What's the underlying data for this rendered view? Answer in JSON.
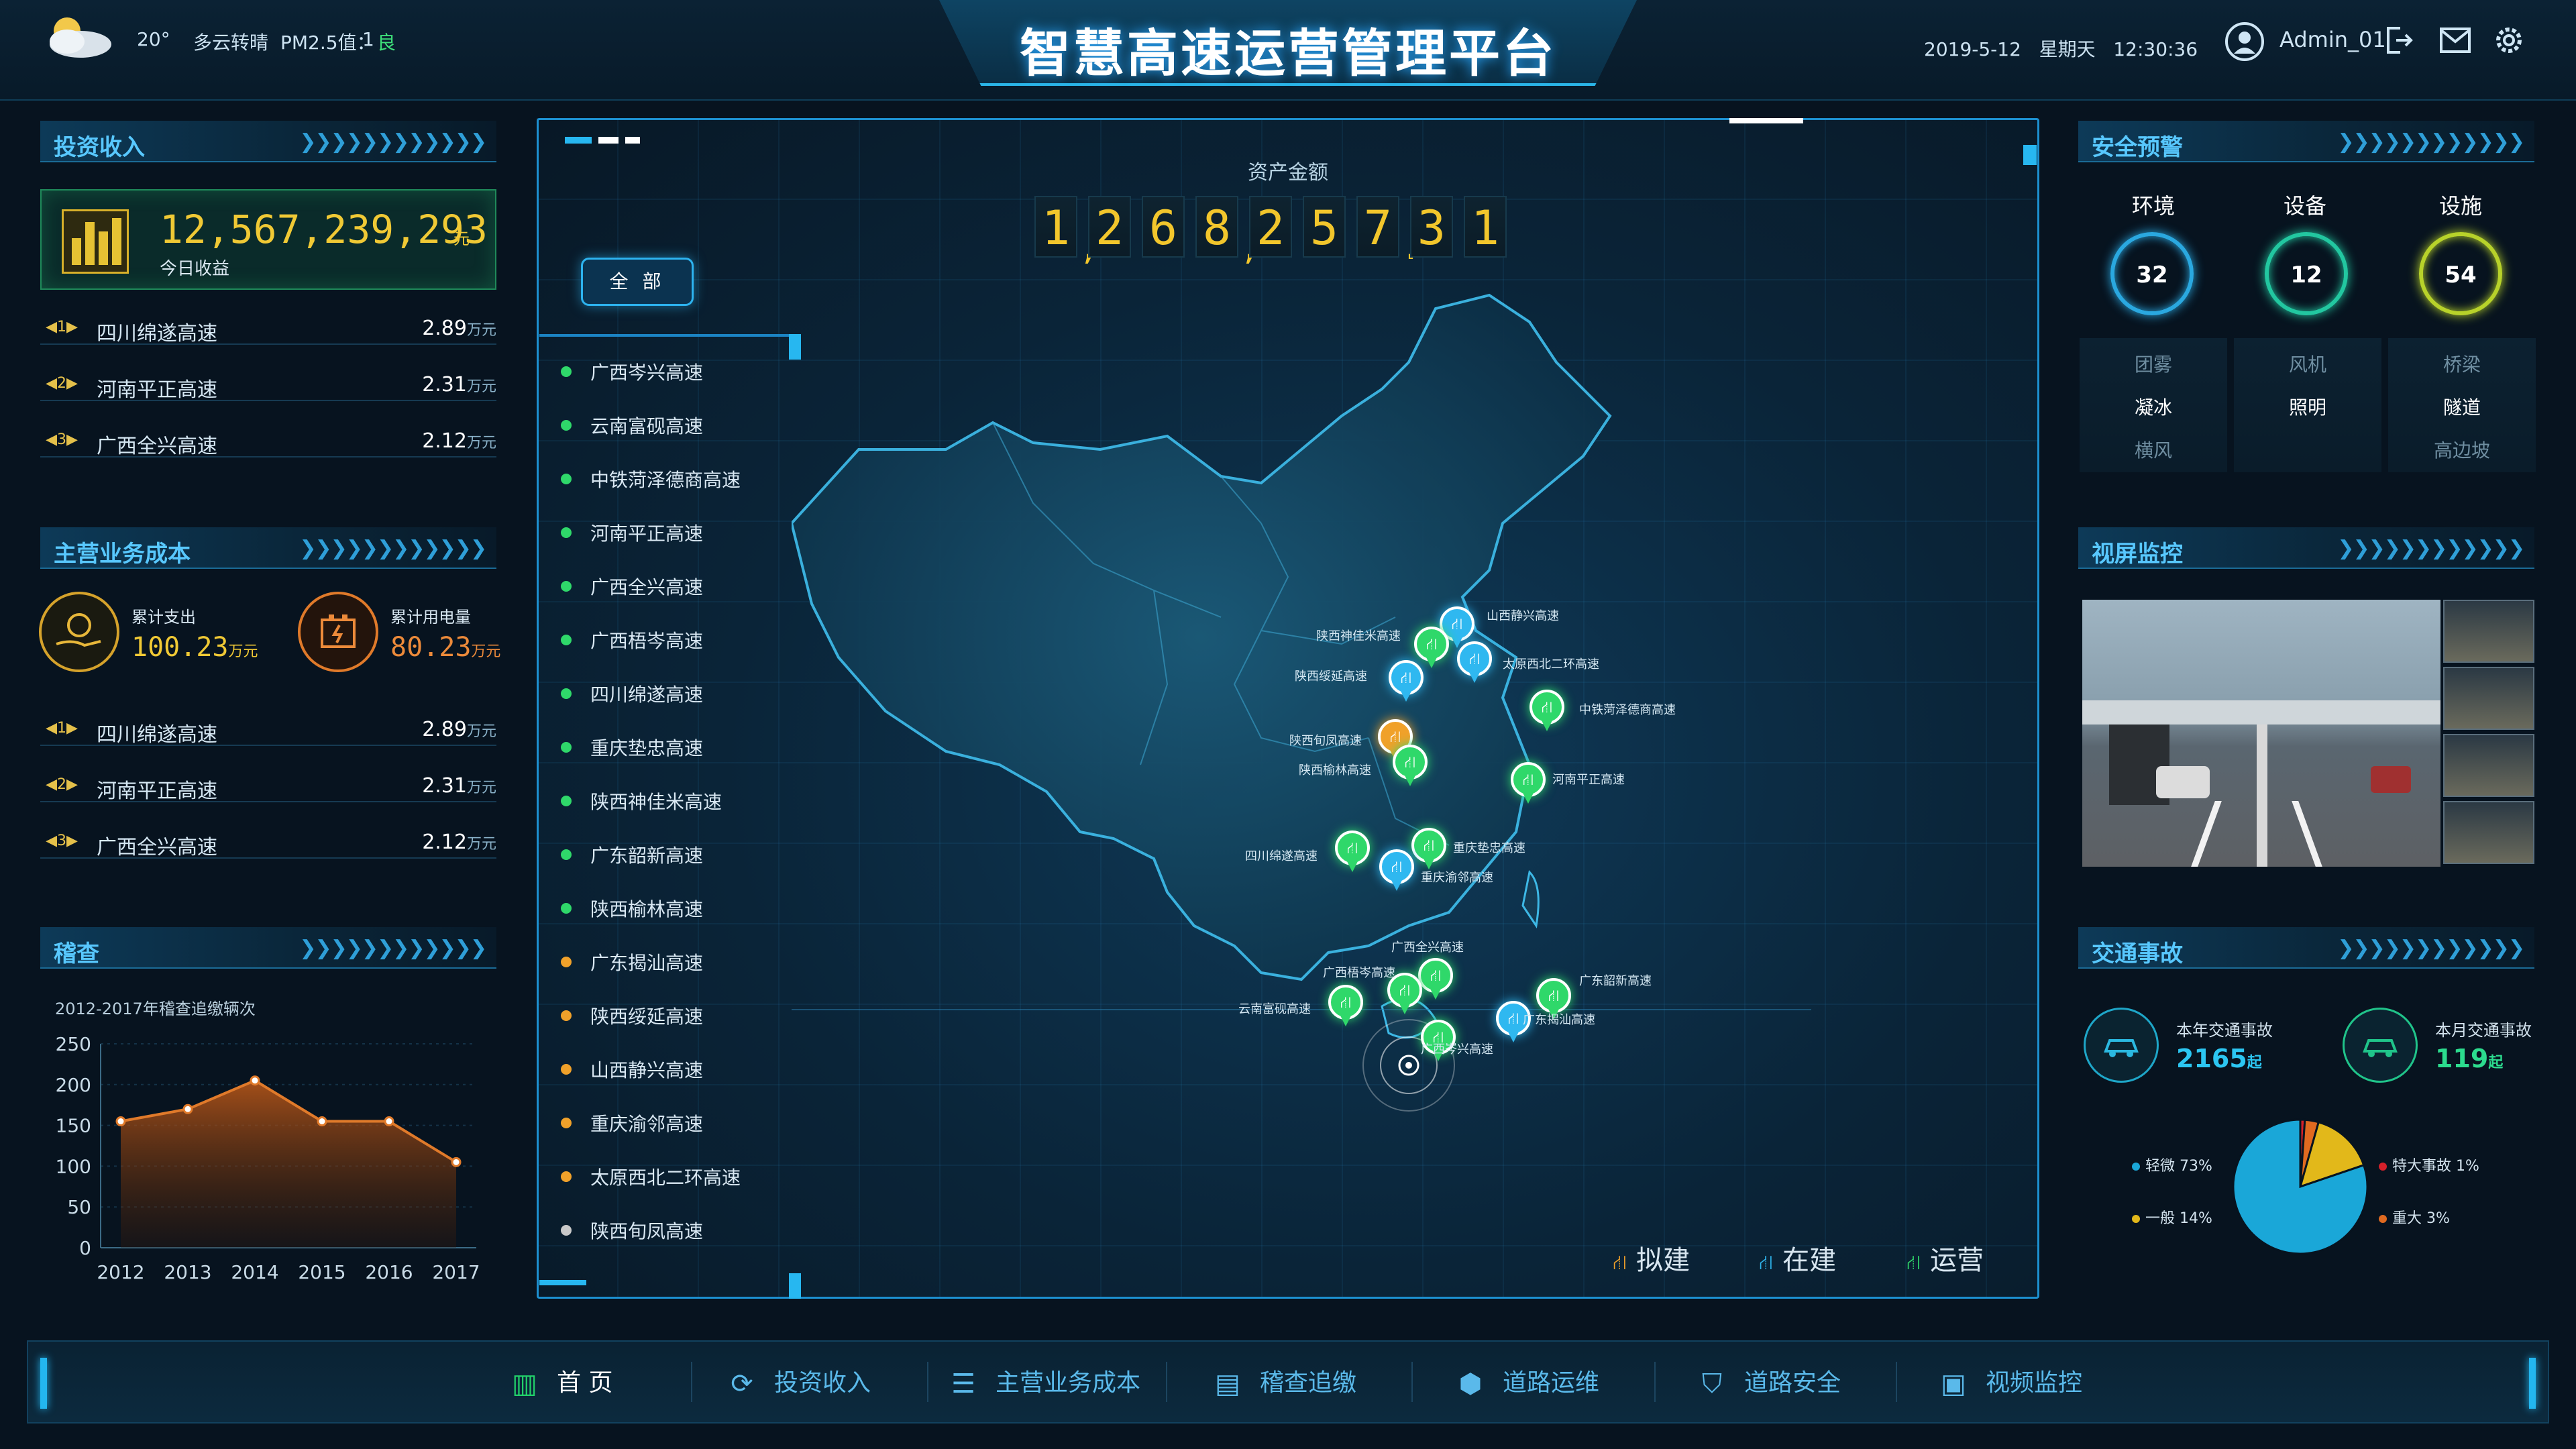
{
  "header": {
    "temperature": "20°",
    "weather": "多云转晴",
    "pm_label": "PM2.5值：",
    "pm_value": "1",
    "pm_quality": "良",
    "title": "智慧高速运营管理平台",
    "datetime": "2019-5-12   星期天   12:30:36",
    "username": "Admin_01"
  },
  "investment": {
    "title": "投资收入",
    "amount": "12,567,239,293",
    "unit": "元",
    "sub": "今日收益",
    "ranking": [
      {
        "rank": "1",
        "name": "四川绵遂高速",
        "value": "2.89",
        "unit": "万元"
      },
      {
        "rank": "2",
        "name": "河南平正高速",
        "value": "2.31",
        "unit": "万元"
      },
      {
        "rank": "3",
        "name": "广西全兴高速",
        "value": "2.12",
        "unit": "万元"
      }
    ]
  },
  "cost": {
    "title": "主营业务成本",
    "expense_label": "累计支出",
    "expense_value": "100.23",
    "expense_unit": "万元",
    "power_label": "累计用电量",
    "power_value": "80.23",
    "power_unit": "万元",
    "ranking": [
      {
        "rank": "1",
        "name": "四川绵遂高速",
        "value": "2.89",
        "unit": "万元"
      },
      {
        "rank": "2",
        "name": "河南平正高速",
        "value": "2.31",
        "unit": "万元"
      },
      {
        "rank": "3",
        "name": "广西全兴高速",
        "value": "2.12",
        "unit": "万元"
      }
    ]
  },
  "audit": {
    "title": "稽查",
    "chart_caption": "2012-2017年稽查追缴辆次"
  },
  "chart_data": {
    "type": "area",
    "title": "2012-2017年稽查追缴辆次",
    "x": [
      "2012",
      "2013",
      "2014",
      "2015",
      "2016",
      "2017"
    ],
    "values": [
      155,
      170,
      205,
      155,
      155,
      105
    ],
    "ylim": [
      0,
      250
    ],
    "yticks": [
      "250",
      "200",
      "150",
      "100",
      "50",
      "0"
    ],
    "color": "#e07a2a",
    "grid": true
  },
  "map": {
    "asset_label": "资产金额",
    "asset_digits": [
      "1",
      "2",
      "6",
      "8",
      "2",
      "5",
      "7",
      "3",
      "1"
    ],
    "asset_seps": [
      ",",
      ",",
      "."
    ],
    "filter_button": "全 部",
    "roads": [
      {
        "name": "广西岑兴高速",
        "color": "#2fd86a"
      },
      {
        "name": "云南富砚高速",
        "color": "#2fd86a"
      },
      {
        "name": "中铁菏泽德商高速",
        "color": "#2fd86a"
      },
      {
        "name": "河南平正高速",
        "color": "#2fd86a"
      },
      {
        "name": "广西全兴高速",
        "color": "#2fd86a"
      },
      {
        "name": "广西梧岑高速",
        "color": "#2fd86a"
      },
      {
        "name": "四川绵遂高速",
        "color": "#2fd86a"
      },
      {
        "name": "重庆垫忠高速",
        "color": "#2fd86a"
      },
      {
        "name": "陕西神佳米高速",
        "color": "#2fd86a"
      },
      {
        "name": "广东韶新高速",
        "color": "#2fd86a"
      },
      {
        "name": "陕西榆林高速",
        "color": "#2fd86a"
      },
      {
        "name": "广东揭汕高速",
        "color": "#f0a12a"
      },
      {
        "name": "陕西绥延高速",
        "color": "#f0a12a"
      },
      {
        "name": "山西静兴高速",
        "color": "#f0a12a"
      },
      {
        "name": "重庆渝邻高速",
        "color": "#f0a12a"
      },
      {
        "name": "太原西北二环高速",
        "color": "#f0a12a"
      },
      {
        "name": "陕西旬凤高速",
        "color": "#c9c9c9"
      }
    ],
    "pins": [
      {
        "label": "山西静兴高速",
        "status": "在建"
      },
      {
        "label": "陕西神佳米高速",
        "status": "运营"
      },
      {
        "label": "太原西北二环高速",
        "status": "在建"
      },
      {
        "label": "陕西绥延高速",
        "status": "在建"
      },
      {
        "label": "中铁菏泽德商高速",
        "status": "运营"
      },
      {
        "label": "陕西旬凤高速",
        "status": "拟建"
      },
      {
        "label": "陕西榆林高速",
        "status": "运营"
      },
      {
        "label": "河南平正高速",
        "status": "运营"
      },
      {
        "label": "四川绵遂高速",
        "status": "运营"
      },
      {
        "label": "重庆垫忠高速",
        "status": "运营"
      },
      {
        "label": "重庆渝邻高速",
        "status": "在建"
      },
      {
        "label": "广西全兴高速",
        "status": "运营"
      },
      {
        "label": "广西梧岑高速",
        "status": "运营"
      },
      {
        "label": "云南富砚高速",
        "status": "运营"
      },
      {
        "label": "广东韶新高速",
        "status": "运营"
      },
      {
        "label": "广东揭汕高速",
        "status": "在建"
      },
      {
        "label": "广西岑兴高速",
        "status": "运营"
      }
    ],
    "legend": [
      "拟建",
      "在建",
      "运营"
    ]
  },
  "safety": {
    "title": "安全预警",
    "columns": [
      {
        "head": "环境",
        "count": "32",
        "items": [
          "团雾",
          "凝冰",
          "横风"
        ],
        "color": "#2aa8e0"
      },
      {
        "head": "设备",
        "count": "12",
        "items": [
          "风机",
          "照明"
        ],
        "color": "#22c7a0"
      },
      {
        "head": "设施",
        "count": "54",
        "items": [
          "桥梁",
          "隧道",
          "高边坡"
        ],
        "color": "#b8d22a"
      }
    ]
  },
  "video": {
    "title": "视屏监控"
  },
  "accident": {
    "title": "交通事故",
    "year_label": "本年交通事故",
    "year_value": "2165",
    "year_unit": "起",
    "month_label": "本月交通事故",
    "month_value": "119",
    "month_unit": "起",
    "pie": [
      {
        "name": "轻微",
        "pct": "73%",
        "value": 73,
        "color": "#1aa7d8"
      },
      {
        "name": "一般",
        "pct": "14%",
        "value": 14,
        "color": "#e2b81a"
      },
      {
        "name": "特大事故",
        "pct": "1%",
        "value": 1,
        "color": "#d6202a"
      },
      {
        "name": "重大",
        "pct": "3%",
        "value": 3,
        "color": "#e06a20"
      }
    ]
  },
  "nav": {
    "items": [
      {
        "label": "首 页",
        "icon": "bar-chart-icon"
      },
      {
        "label": "投资收入",
        "icon": "share-icon"
      },
      {
        "label": "主营业务成本",
        "icon": "database-icon"
      },
      {
        "label": "稽查追缴",
        "icon": "audit-icon"
      },
      {
        "label": "道路运维",
        "icon": "maintenance-icon"
      },
      {
        "label": "道路安全",
        "icon": "shield-icon"
      },
      {
        "label": "视频监控",
        "icon": "monitor-icon"
      }
    ]
  }
}
